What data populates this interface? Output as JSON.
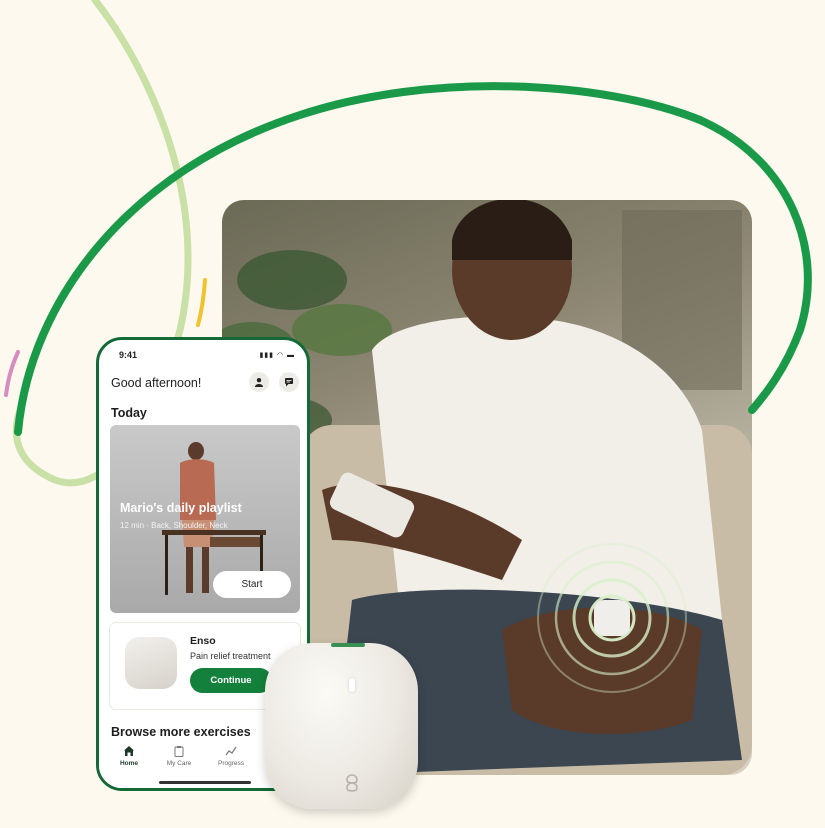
{
  "colors": {
    "background": "#fdf9ee",
    "brand_green": "#13803b",
    "phone_frame": "#136a36",
    "light_green": "#c9e0a6",
    "accent_yellow": "#f2c12e",
    "accent_pink": "#d88bbf"
  },
  "phone": {
    "status_time": "9:41",
    "greeting": "Good afternoon!",
    "header_icons": [
      "profile-icon",
      "chat-icon"
    ],
    "today_heading": "Today",
    "playlist": {
      "title": "Mario's daily playlist",
      "subtitle": "12 min · Back, Shoulder, Neck",
      "start_label": "Start"
    },
    "enso_card": {
      "title": "Enso",
      "subtitle": "Pain relief treatment",
      "continue_label": "Continue"
    },
    "browse_heading": "Browse more exercises",
    "nav": [
      {
        "label": "Home",
        "icon": "home-icon",
        "active": true
      },
      {
        "label": "My Care",
        "icon": "clipboard-icon",
        "active": false
      },
      {
        "label": "Progress",
        "icon": "trend-icon",
        "active": false
      }
    ]
  },
  "device": {
    "icon": "enso-logo-icon"
  }
}
